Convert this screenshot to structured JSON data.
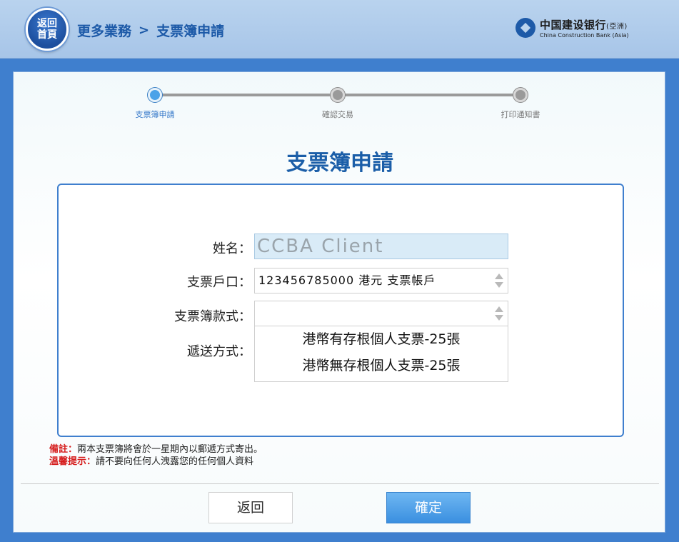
{
  "header": {
    "home_line1": "返回",
    "home_line2": "首頁",
    "breadcrumb": [
      "更多業務",
      "支票簿申請"
    ],
    "breadcrumb_sep": ">",
    "bank_name_cn": "中国建设银行",
    "bank_name_cn_suffix": "(亞洲)",
    "bank_name_en": "China Construction Bank (Asia)"
  },
  "steps": [
    {
      "label": "支票簿申請",
      "active": true
    },
    {
      "label": "確認交易",
      "active": false
    },
    {
      "label": "打印通知書",
      "active": false
    }
  ],
  "page_title": "支票簿申請",
  "form": {
    "name_label": "姓名：",
    "name_value": "CCBA Client",
    "account_label": "支票戶口：",
    "account_value": "123456785000 港元 支票帳戶",
    "style_label": "支票簿款式：",
    "style_value": "",
    "style_options": [
      "港幣有存根個人支票-25張",
      "港幣無存根個人支票-25張"
    ],
    "delivery_label": "遞送方式："
  },
  "notes": {
    "remark_label": "備註：",
    "remark_text": "兩本支票簿將會於一星期內以郵遞方式寄出。",
    "tip_label": "溫馨提示：",
    "tip_text": "請不要向任何人洩露您的任何個人資料"
  },
  "buttons": {
    "back": "返回",
    "confirm": "確定"
  },
  "colors": {
    "brand_blue": "#1b5ea8",
    "accent_blue": "#3f7fce",
    "warning_red": "#d51b1b"
  }
}
